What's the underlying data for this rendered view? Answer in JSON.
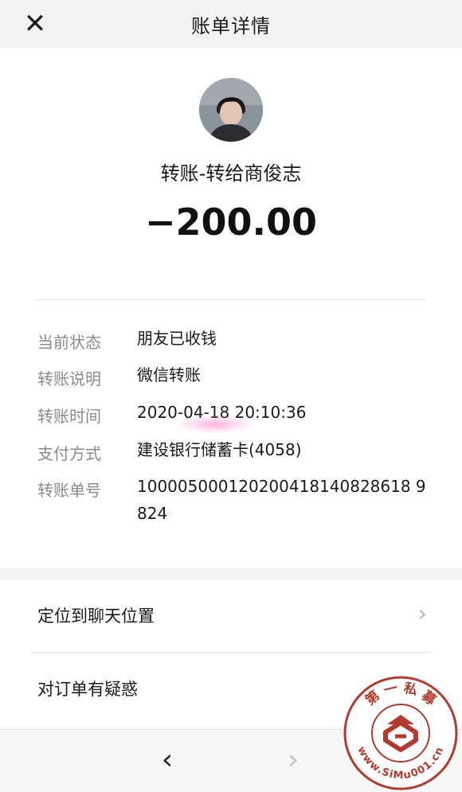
{
  "nav": {
    "close_glyph": "✕",
    "title": "账单详情"
  },
  "header": {
    "subject": "转账-转给商俊志",
    "amount": "−200.00"
  },
  "details": [
    {
      "label": "当前状态",
      "value": "朋友已收钱"
    },
    {
      "label": "转账说明",
      "value": "微信转账"
    },
    {
      "label": "转账时间",
      "value": "2020-04-18 20:10:36"
    },
    {
      "label": "支付方式",
      "value": "建设银行储蓄卡(4058)"
    },
    {
      "label": "转账单号",
      "value": "100005000120200418140828618 9824"
    }
  ],
  "links": {
    "locate_chat": "定位到聊天位置",
    "order_question": "对订单有疑惑"
  },
  "bottom": {
    "back_glyph": "‹",
    "forward_glyph": "›"
  },
  "watermark": {
    "top_text": "第 一 私 募",
    "bottom_text": "www.SiMu001.cn"
  },
  "colors": {
    "nav_bg": "#f2f2f2",
    "label_gray": "#8a8a8a",
    "watermark_red": "#b23a2e"
  }
}
